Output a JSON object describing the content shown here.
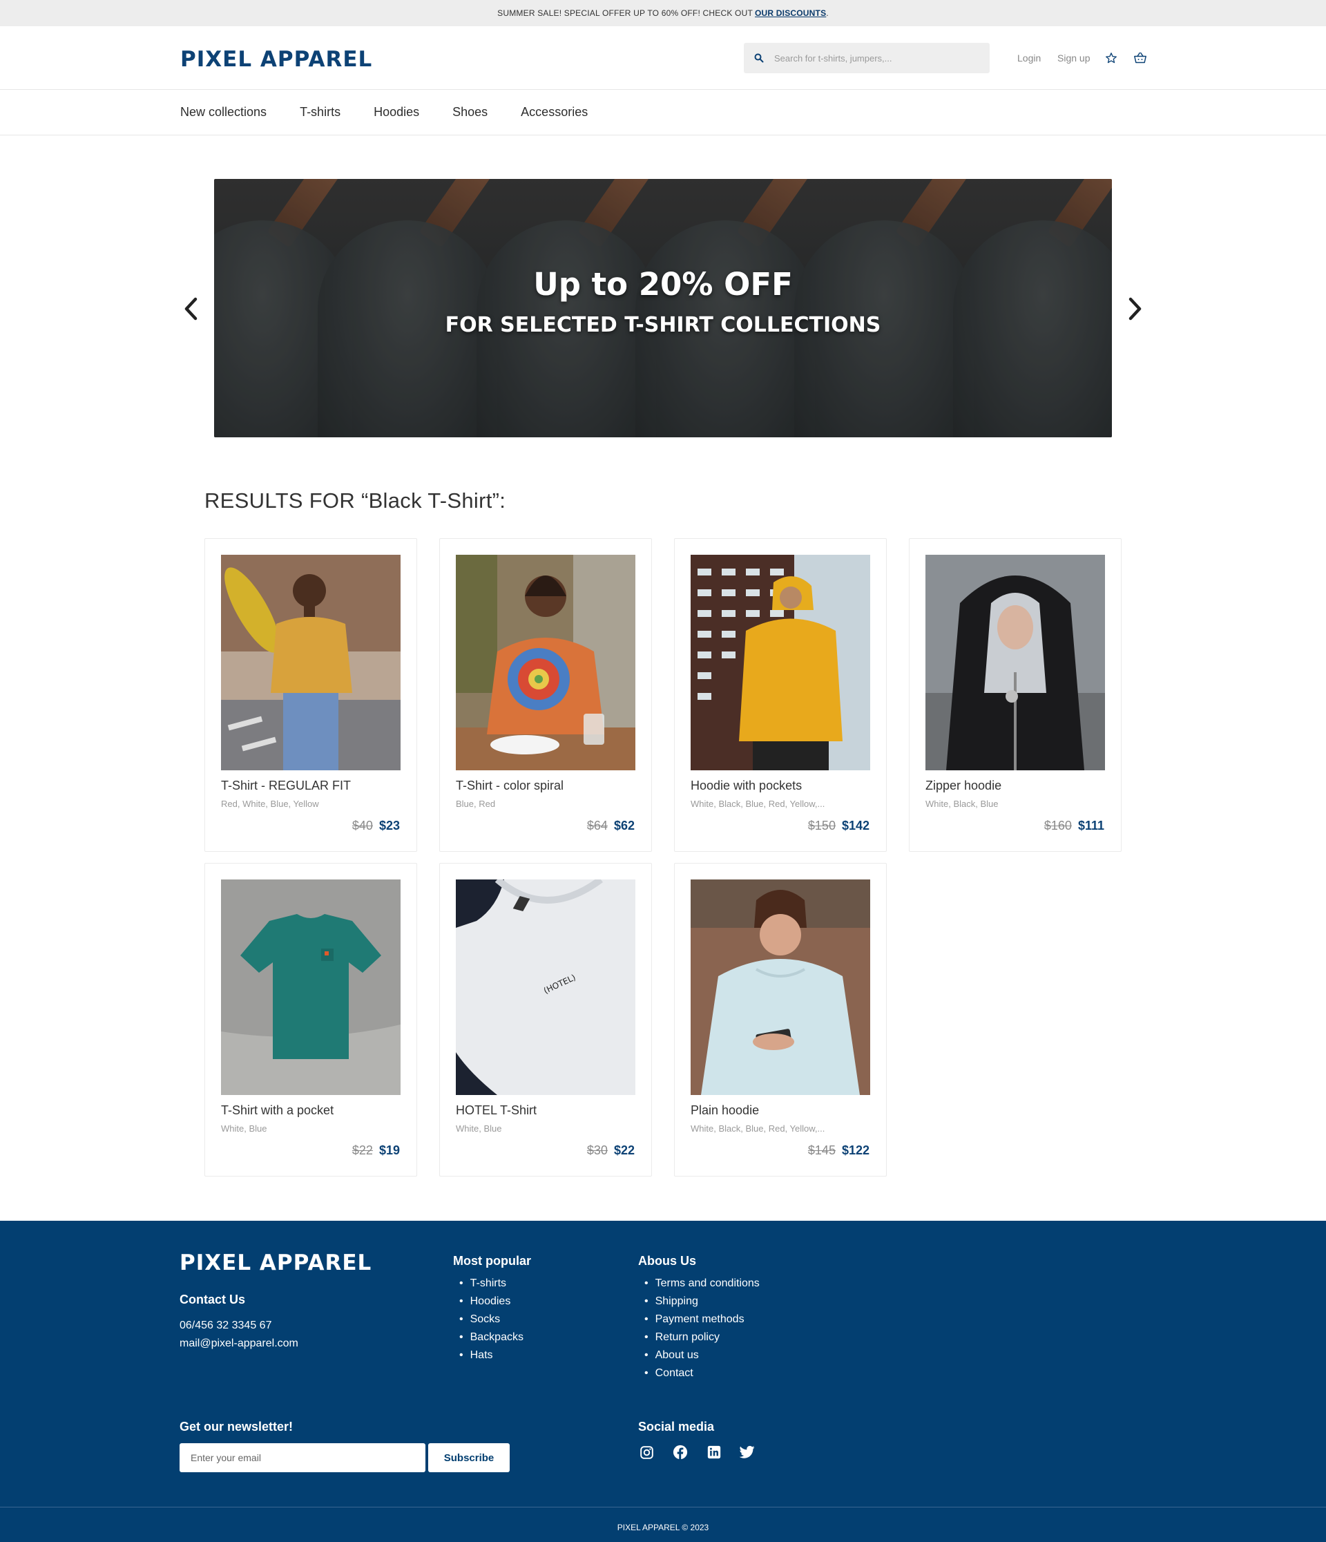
{
  "announcement": {
    "text": "SUMMER SALE! SPECIAL OFFER UP TO 60% OFF! CHECK OUT",
    "link": "OUR DISCOUNTS",
    "suffix": "."
  },
  "header": {
    "logo": "PIXEL APPAREL",
    "search_placeholder": "Search for t-shirts, jumpers,...",
    "login": "Login",
    "signup": "Sign up"
  },
  "nav": [
    "New collections",
    "T-shirts",
    "Hoodies",
    "Shoes",
    "Accessories"
  ],
  "hero": {
    "title": "Up to 20% OFF",
    "subtitle": "FOR SELECTED T-SHIRT COLLECTIONS"
  },
  "results": {
    "title": "RESULTS FOR “Black T-Shirt”:",
    "products": [
      {
        "name": "T-Shirt - REGULAR FIT",
        "colors": "Red, White, Blue, Yellow",
        "old_price": "$40",
        "price": "$23",
        "photo": "man-yellow-tshirt-skateboard"
      },
      {
        "name": "T-Shirt - color spiral",
        "colors": "Blue, Red",
        "old_price": "$64",
        "price": "$62",
        "photo": "woman-tie-dye-tshirt"
      },
      {
        "name": "Hoodie with pockets",
        "colors": "White, Black, Blue, Red, Yellow,...",
        "old_price": "$150",
        "price": "$142",
        "photo": "man-yellow-hoodie"
      },
      {
        "name": "Zipper hoodie",
        "colors": "White, Black, Blue",
        "old_price": "$160",
        "price": "$111",
        "photo": "woman-black-hoodie"
      },
      {
        "name": "T-Shirt with a pocket",
        "colors": "White, Blue",
        "old_price": "$22",
        "price": "$19",
        "photo": "green-tshirt-flatlay"
      },
      {
        "name": "HOTEL T-Shirt",
        "colors": "White, Blue",
        "old_price": "$30",
        "price": "$22",
        "photo": "white-hotel-tshirt",
        "print": "(HOTEL)"
      },
      {
        "name": "Plain hoodie",
        "colors": "White, Black, Blue, Red, Yellow,...",
        "old_price": "$145",
        "price": "$122",
        "photo": "man-light-blue-hoodie"
      }
    ]
  },
  "footer": {
    "logo": "PIXEL APPAREL",
    "contact_heading": "Contact Us",
    "phone": "06/456 32 3345 67",
    "email": "mail@pixel-apparel.com",
    "popular_heading": "Most popular",
    "popular": [
      "T-shirts",
      "Hoodies",
      "Socks",
      "Backpacks",
      "Hats"
    ],
    "about_heading": "Abous Us",
    "about": [
      "Terms and conditions",
      "Shipping",
      "Payment methods",
      "Return policy",
      "About us",
      "Contact"
    ],
    "newsletter_heading": "Get our newsletter!",
    "newsletter_placeholder": "Enter your email",
    "subscribe": "Subscribe",
    "social_heading": "Social media",
    "social": [
      "instagram-icon",
      "facebook-icon",
      "linkedin-icon",
      "twitter-icon"
    ],
    "copyright": "PIXEL APPAREL © 2023"
  },
  "colors": {
    "brand": "#0d4275",
    "footer_bg": "#033f71",
    "announce_bg": "#ededed"
  }
}
